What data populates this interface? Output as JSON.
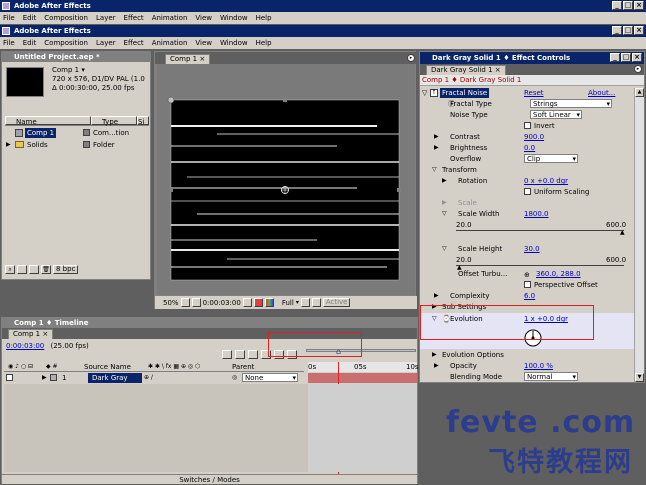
{
  "app": {
    "title": "Adobe After Effects",
    "menu": [
      "File",
      "Edit",
      "Composition",
      "Layer",
      "Effect",
      "Animation",
      "View",
      "Window",
      "Help"
    ]
  },
  "project": {
    "title": "Untitled Project.aep *",
    "comp_name": "Comp 1 ▾",
    "comp_info1": "720 x 576, D1/DV PAL (1.0",
    "comp_info2": "Δ 0:00:30:00, 25.00 fps",
    "columns": [
      "Name",
      "Type",
      "Si"
    ],
    "items": [
      {
        "name": "Comp 1",
        "type": "Com...tion"
      },
      {
        "name": "Solids",
        "type": "Folder"
      }
    ],
    "bpc": "8 bpc"
  },
  "comp": {
    "tab": "Comp 1 ×",
    "zoom": "50%",
    "timecode": "0:00:03:00",
    "resolution": "Full",
    "active": "Active"
  },
  "effects": {
    "title": "Dark Gray Solid 1 ♦ Effect Controls",
    "tab": "Dark Gray Solid 1 ×",
    "breadcrumb": "Comp 1 ♦ Dark Gray Solid 1",
    "effect_name": "Fractal Noise",
    "reset": "Reset",
    "about": "About...",
    "props": {
      "fractal_type": {
        "label": "Fractal Type",
        "value": "Strings"
      },
      "noise_type": {
        "label": "Noise Type",
        "value": "Soft Linear"
      },
      "invert": "Invert",
      "contrast": {
        "label": "Contrast",
        "value": "900.0"
      },
      "brightness": {
        "label": "Brightness",
        "value": "0.0"
      },
      "overflow": {
        "label": "Overflow",
        "value": "Clip"
      },
      "transform": "Transform",
      "rotation": {
        "label": "Rotation",
        "value": "0 x +0.0 dgr"
      },
      "uniform": "Uniform Scaling",
      "scale": "Scale",
      "scale_width": {
        "label": "Scale Width",
        "value": "1800.0",
        "min": "20.0",
        "max": "600.0"
      },
      "scale_height": {
        "label": "Scale Height",
        "value": "30.0",
        "min": "20.0",
        "max": "600.0"
      },
      "offset": {
        "label": "Offset Turbu...",
        "value": "360.0, 288.0"
      },
      "perspective": "Perspective Offset",
      "complexity": {
        "label": "Complexity",
        "value": "6.0"
      },
      "sub": "Sub Settings",
      "evolution": {
        "label": "Evolution",
        "value": "1 x +0.0 dgr"
      },
      "evo_options": "Evolution Options",
      "opacity": {
        "label": "Opacity",
        "value": "100.0 %"
      },
      "blending": {
        "label": "Blending Mode",
        "value": "Normal"
      }
    }
  },
  "timeline": {
    "title": "Comp 1 ♦ Timeline",
    "tab": "Comp 1 ×",
    "timecode": "0:00:03:00",
    "fps": "(25.00 fps)",
    "source_name": "Source Name",
    "parent": "Parent",
    "layer_num": "1",
    "layer_name": "Dark Gray",
    "parent_value": "None",
    "ruler": [
      "0s",
      "05s",
      "10s"
    ],
    "footer": "Switches / Modes"
  },
  "watermark": {
    "line1": "fevte .com",
    "line2": "飞特教程网"
  }
}
